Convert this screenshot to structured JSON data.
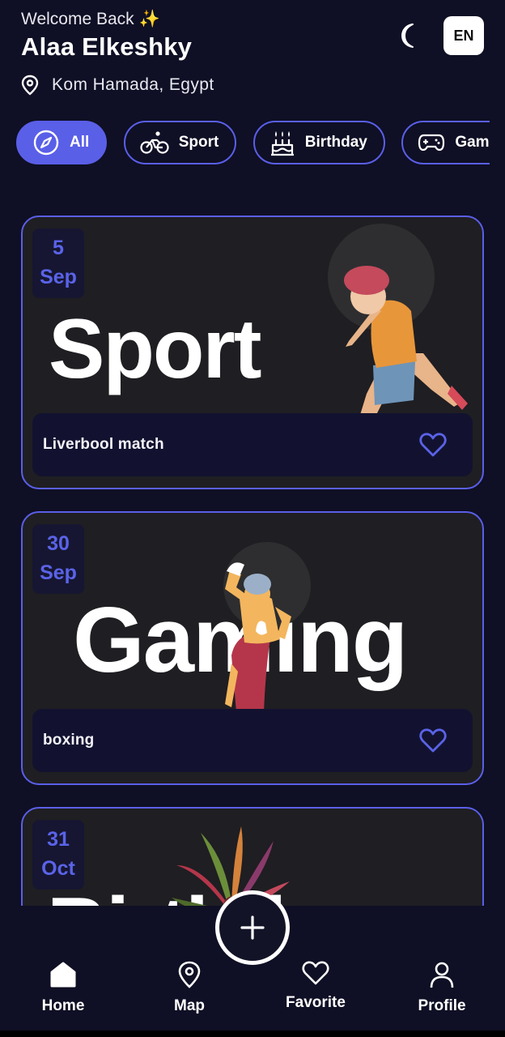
{
  "header": {
    "welcome": "Welcome Back",
    "sparkle": "✨",
    "username": "Alaa Elkeshky",
    "location": "Kom Hamada, Egypt",
    "theme_icon": "moon-icon",
    "language": "EN"
  },
  "categories": [
    {
      "label": "All",
      "icon": "compass-icon",
      "active": true
    },
    {
      "label": "Sport",
      "icon": "bicycle-icon",
      "active": false
    },
    {
      "label": "Birthday",
      "icon": "cake-icon",
      "active": false
    },
    {
      "label": "Gamin",
      "icon": "gamepad-icon",
      "active": false
    }
  ],
  "events": [
    {
      "day": "5",
      "month": "Sep",
      "category_word": "Sport",
      "title": "Liverbool match",
      "favorite_icon": "heart-icon"
    },
    {
      "day": "30",
      "month": "Sep",
      "category_word": "Gaming",
      "title": "boxing",
      "favorite_icon": "heart-icon"
    },
    {
      "day": "31",
      "month": "Oct",
      "category_word": "Birthday",
      "title": "",
      "favorite_icon": "heart-icon"
    }
  ],
  "bottom_nav": {
    "items": [
      {
        "label": "Home",
        "icon": "home-icon"
      },
      {
        "label": "Map",
        "icon": "map-pin-icon"
      },
      {
        "label": "Favorite",
        "icon": "heart-icon"
      },
      {
        "label": "Profile",
        "icon": "user-icon"
      }
    ],
    "fab_icon": "plus-icon"
  },
  "colors": {
    "background": "#0f0f25",
    "accent": "#5a5fe8",
    "card": "#1f1e22",
    "card_footer": "#121230"
  }
}
